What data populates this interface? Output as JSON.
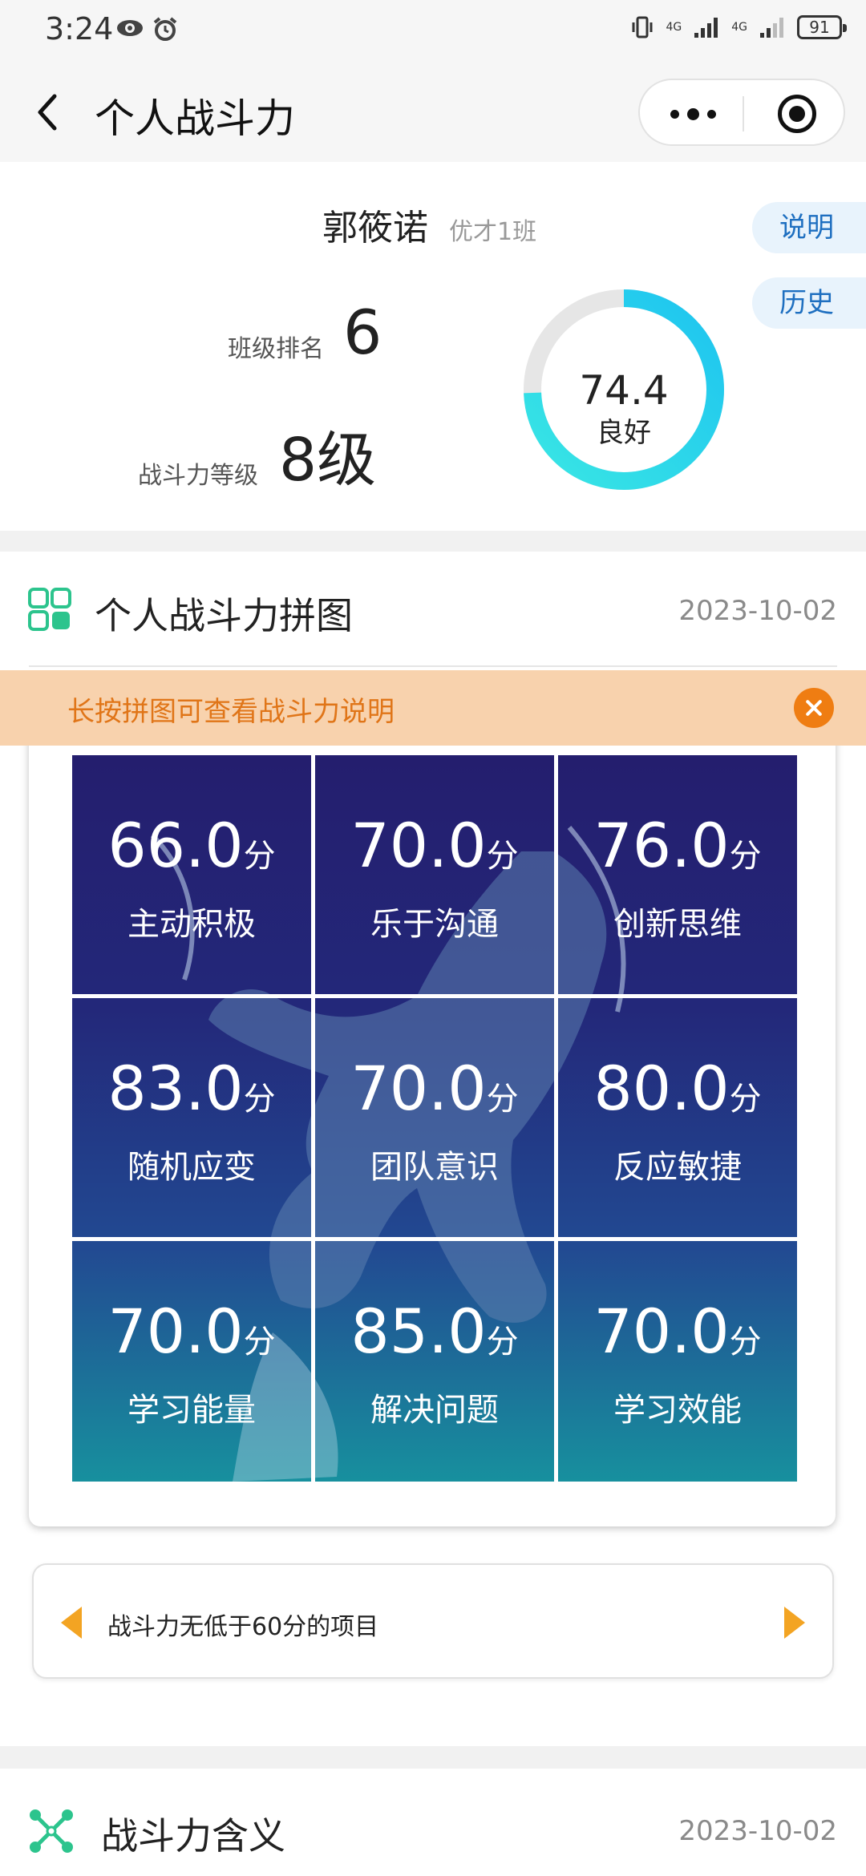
{
  "status_bar": {
    "time": "3:24",
    "network_1": "4G",
    "network_2": "4G",
    "battery": "91"
  },
  "nav": {
    "title": "个人战斗力"
  },
  "profile": {
    "name": "郭筱诺",
    "class": "优才1班",
    "explain_button": "说明",
    "history_button": "历史",
    "rank_label": "班级排名",
    "rank_value": "6",
    "level_label": "战斗力等级",
    "level_value": "8级",
    "score": "74.4",
    "grade": "良好",
    "score_fraction": 0.744,
    "ring_colors": [
      "#2ed3ea",
      "#1ec4f0",
      "#39e6e4"
    ]
  },
  "puzzle_section": {
    "title": "个人战斗力拼图",
    "date": "2023-10-02",
    "tip": "长按拼图可查看战斗力说明",
    "unit": "分",
    "tiles": [
      {
        "score": "66.0",
        "label": "主动积极"
      },
      {
        "score": "70.0",
        "label": "乐于沟通"
      },
      {
        "score": "76.0",
        "label": "创新思维"
      },
      {
        "score": "83.0",
        "label": "随机应变"
      },
      {
        "score": "70.0",
        "label": "团队意识"
      },
      {
        "score": "80.0",
        "label": "反应敏捷"
      },
      {
        "score": "70.0",
        "label": "学习能量"
      },
      {
        "score": "85.0",
        "label": "解决问题"
      },
      {
        "score": "70.0",
        "label": "学习效能"
      }
    ],
    "low_items_text": "战斗力无低于60分的项目"
  },
  "meaning_section": {
    "title": "战斗力含义",
    "date": "2023-10-02"
  },
  "colors": {
    "accent_green": "#2cc48d",
    "accent_blue": "#1e6fc0",
    "tip_orange": "#ef7d12",
    "arrow_orange": "#f3a423"
  }
}
